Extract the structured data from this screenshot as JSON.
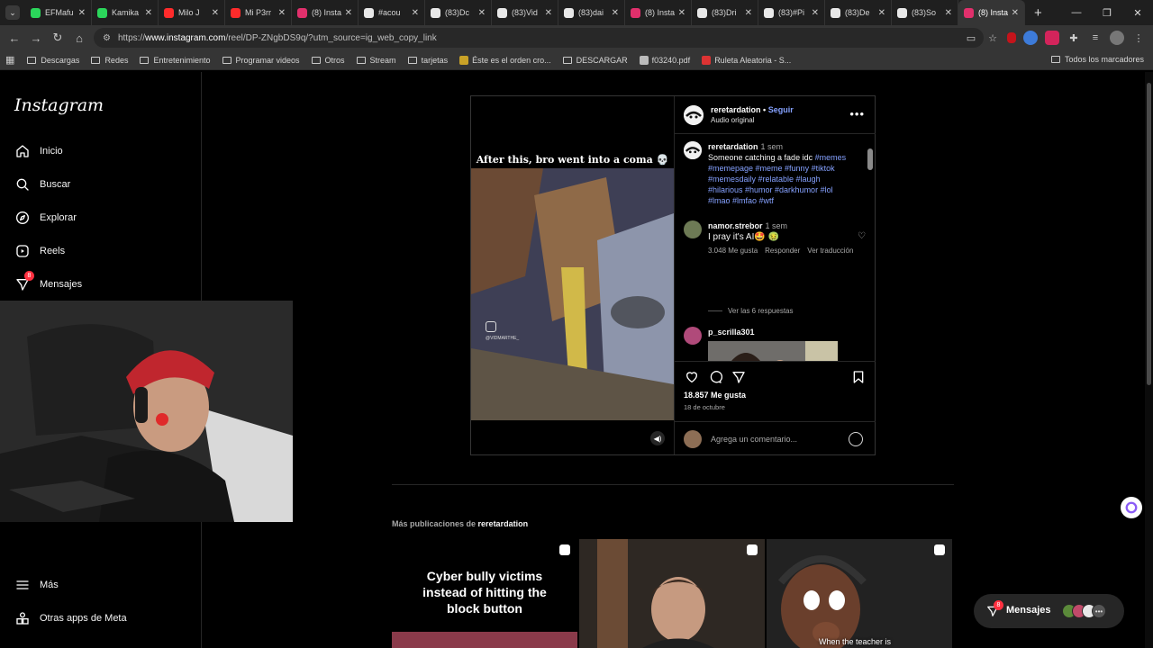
{
  "browser": {
    "tabs": [
      {
        "title": "EFMafu",
        "color": "#2bd65b"
      },
      {
        "title": "Kamika",
        "color": "#2bd65b"
      },
      {
        "title": "Milo J",
        "color": "#ff2b2b"
      },
      {
        "title": "Mi P3rr",
        "color": "#ff2b2b"
      },
      {
        "title": "(8) Insta",
        "color": "#e1306c"
      },
      {
        "title": "#acou",
        "color": "#e8e8e8"
      },
      {
        "title": "(83)Dc",
        "color": "#e8e8e8"
      },
      {
        "title": "(83)Vid",
        "color": "#e8e8e8"
      },
      {
        "title": "(83)dai",
        "color": "#e8e8e8"
      },
      {
        "title": "(8) Insta",
        "color": "#e1306c"
      },
      {
        "title": "(83)Dri",
        "color": "#e8e8e8"
      },
      {
        "title": "(83)#Pi",
        "color": "#e8e8e8"
      },
      {
        "title": "(83)De",
        "color": "#e8e8e8"
      },
      {
        "title": "(83)So",
        "color": "#e8e8e8"
      },
      {
        "title": "(8) Insta",
        "color": "#e1306c",
        "active": true
      }
    ],
    "url_prefix": "https://",
    "url_domain": "www.instagram.com",
    "url_rest": "/reel/DP-ZNgbDS9q/?utm_source=ig_web_copy_link",
    "bookmarks": [
      "Descargas",
      "Redes",
      "Entretenimiento",
      "Programar videos",
      "Otros",
      "Stream",
      "tarjetas",
      "Éste es el orden cro...",
      "DESCARGAR",
      "f03240.pdf",
      "Ruleta Aleatoria - S..."
    ],
    "bookmarks_right": "Todos los marcadores"
  },
  "sidebar": {
    "logo": "Instagram",
    "items": [
      {
        "label": "Inicio",
        "icon": "home-icon"
      },
      {
        "label": "Buscar",
        "icon": "search-icon"
      },
      {
        "label": "Explorar",
        "icon": "compass-icon"
      },
      {
        "label": "Reels",
        "icon": "reels-icon"
      },
      {
        "label": "Mensajes",
        "icon": "messenger-icon",
        "badge": "8"
      }
    ],
    "more": "Más",
    "meta_apps": "Otras apps de Meta"
  },
  "post": {
    "video_caption": "After this, bro went into a coma 💀",
    "video_watermark": "@VIDMARTHE_",
    "username": "reretardation",
    "separator": "•",
    "follow": "Seguir",
    "audio": "Audio original",
    "author_comment": {
      "user": "reretardation",
      "time": "1 sem",
      "text": "Someone catching a fade idc",
      "tags": "#memes #memepage #meme #funny #tiktok #memesdaily #relatable #laugh #hilarious #humor #darkhumor #lol #lmao #lmfao #wtf"
    },
    "comment1": {
      "user": "namor.strebor",
      "time": "1 sem",
      "text": "I pray it's AI🤩 🤢",
      "likes": "3.048 Me gusta",
      "reply": "Responder",
      "translate": "Ver traducción"
    },
    "view_replies": "Ver las 6 respuestas",
    "comment2": {
      "user": "p_scrilla301"
    },
    "likes": "18.857 Me gusta",
    "date": "18 de octubre",
    "add_comment_placeholder": "Agrega un comentario..."
  },
  "more": {
    "prefix": "Más publicaciones de",
    "user": "reretardation",
    "thumbs": [
      {
        "text": "Cyber bully victims instead of hitting the block button",
        "sub": ""
      },
      {
        "text": "",
        "sub": ""
      },
      {
        "text": "",
        "sub": "When the teacher is"
      }
    ]
  },
  "messages_pill": {
    "label": "Mensajes",
    "badge": "8"
  },
  "colors": {
    "link": "#85a1ff",
    "badge": "#ff3040",
    "background": "#000000"
  }
}
